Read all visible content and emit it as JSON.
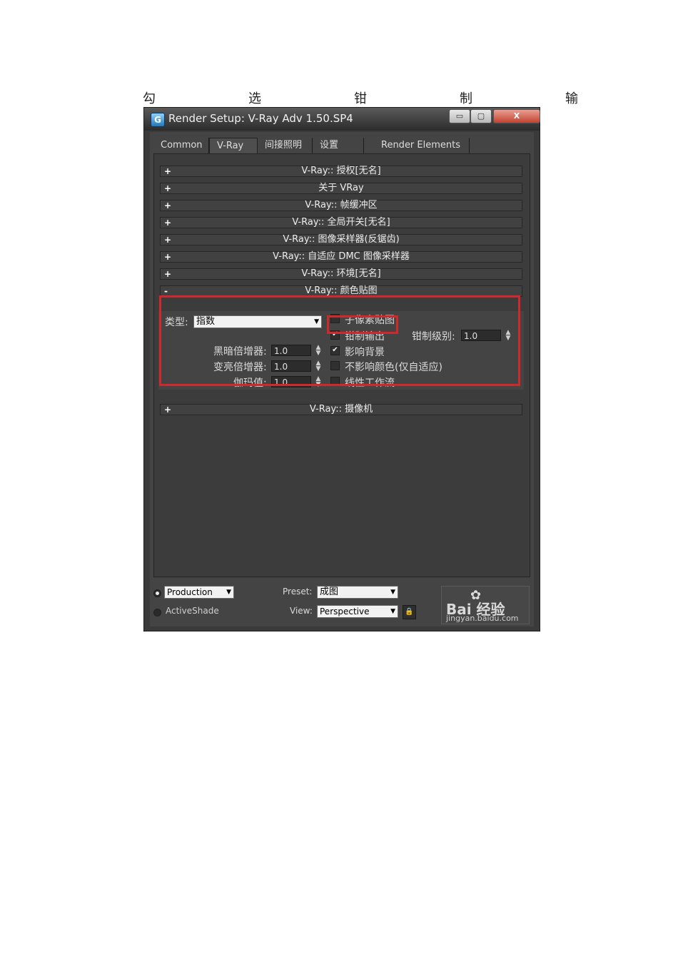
{
  "doc_heading": [
    "勾",
    "选",
    "钳",
    "制",
    "输"
  ],
  "window": {
    "title": "Render Setup: V-Ray Adv 1.50.SP4",
    "app_icon_letter": "G",
    "min_label": "▭",
    "max_label": "▢",
    "close_label": "X"
  },
  "tabs": [
    {
      "label": "Common",
      "active": false
    },
    {
      "label": "V-Ray",
      "active": true
    },
    {
      "label": "间接照明",
      "active": false
    },
    {
      "label": "设置",
      "active": false
    },
    {
      "label": "Render Elements",
      "active": false
    }
  ],
  "rollouts": [
    {
      "label": "V-Ray:: 授权[无名]",
      "sign": "+"
    },
    {
      "label": "关于 VRay",
      "sign": "+"
    },
    {
      "label": "V-Ray:: 帧缓冲区",
      "sign": "+"
    },
    {
      "label": "V-Ray:: 全局开关[无名]",
      "sign": "+"
    },
    {
      "label": "V-Ray:: 图像采样器(反锯齿)",
      "sign": "+"
    },
    {
      "label": "V-Ray:: 自适应 DMC 图像采样器",
      "sign": "+"
    },
    {
      "label": "V-Ray:: 环境[无名]",
      "sign": "+"
    },
    {
      "label": "V-Ray:: 颜色贴图",
      "sign": "-"
    }
  ],
  "color_map": {
    "type_label": "类型:",
    "type_value": "指数",
    "dark_mult_label": "黑暗倍增器:",
    "dark_mult_value": "1.0",
    "bright_mult_label": "变亮倍增器:",
    "bright_mult_value": "1.0",
    "gamma_label": "伽玛值:",
    "gamma_value": "1.0",
    "subpixel_label": "子像素贴图",
    "subpixel_checked": false,
    "clamp_label": "钳制输出",
    "clamp_checked": true,
    "clamp_level_label": "钳制级别:",
    "clamp_level_value": "1.0",
    "affect_bg_label": "影响背景",
    "affect_bg_checked": true,
    "dont_affect_label": "不影响颜色(仅自适应)",
    "dont_affect_checked": false,
    "linear_label": "线性工作流",
    "linear_checked": false,
    "check_mark": "✔"
  },
  "camera_rollout": {
    "label": "V-Ray:: 摄像机",
    "sign": "+"
  },
  "bottom": {
    "production_label": "Production",
    "activeshade_label": "ActiveShade",
    "preset_label": "Preset:",
    "preset_value": "成图",
    "view_label": "View:",
    "view_value": "Perspective",
    "dropdown_glyph": "▼",
    "lock_glyph": "🔒"
  },
  "watermark": {
    "logo": "Bai  经验",
    "url": "jingyan.baidu.com"
  },
  "colors": {
    "highlight_box": "#d0282b",
    "panel_bg": "#444444"
  }
}
